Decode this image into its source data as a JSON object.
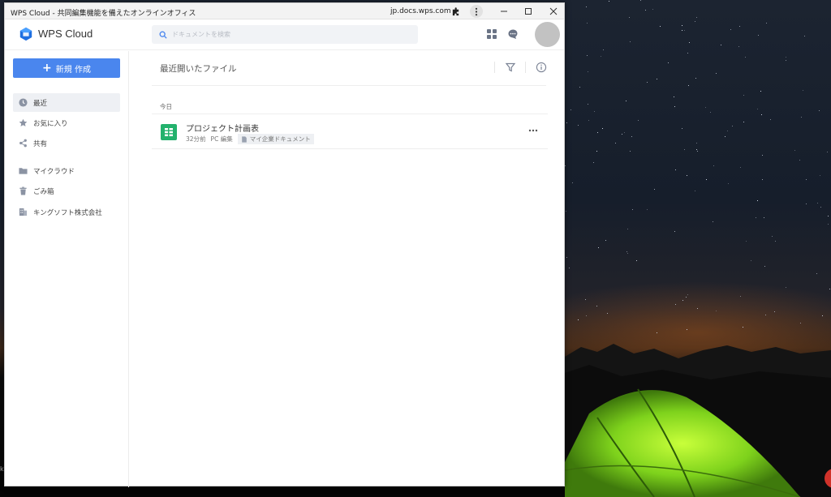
{
  "window": {
    "title": "WPS Cloud - 共同編集機能を備えたオンラインオフィス",
    "url": "jp.docs.wps.com"
  },
  "header": {
    "brand": "WPS Cloud",
    "search_placeholder": "ドキュメントを検索"
  },
  "sidebar": {
    "new_button_label": "新規 作成",
    "items": [
      {
        "label": "最近",
        "icon": "clock-icon",
        "active": true
      },
      {
        "label": "お気に入り",
        "icon": "star-icon"
      },
      {
        "label": "共有",
        "icon": "share-icon"
      },
      {
        "label": "マイクラウド",
        "icon": "folder-icon"
      },
      {
        "label": "ごみ箱",
        "icon": "trash-icon"
      },
      {
        "label": "キングソフト株式会社",
        "icon": "building-icon"
      }
    ]
  },
  "main": {
    "title": "最近開いたファイル",
    "section_label": "今日",
    "files": [
      {
        "name": "プロジェクト計画表",
        "time": "32分前",
        "action": "PC 編集",
        "location": "マイ企業ドキュメント"
      }
    ]
  },
  "colors": {
    "accent": "#4a86ee",
    "sheet_icon": "#23b26d"
  },
  "desktop": {
    "edge_text": "k"
  }
}
